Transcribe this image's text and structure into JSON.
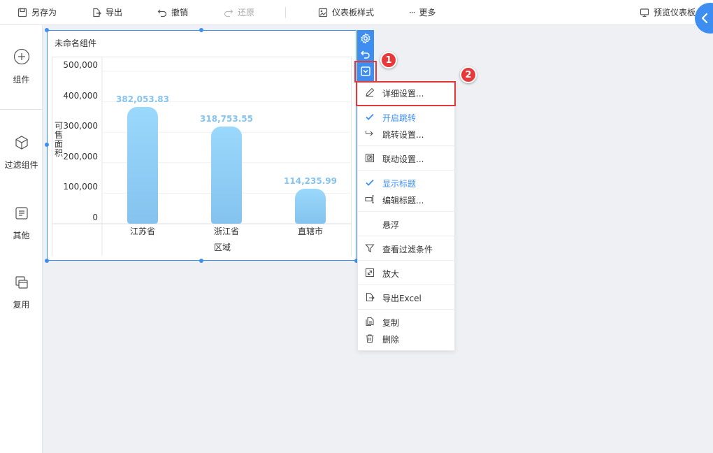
{
  "toolbar": {
    "save_as": "另存为",
    "export": "导出",
    "undo": "撤销",
    "redo": "还原",
    "style": "仪表板样式",
    "more": "更多",
    "preview": "预览仪表板"
  },
  "sidebar": {
    "items": [
      {
        "label": "组件",
        "icon": "add-circle-icon"
      },
      {
        "label": "过滤组件",
        "icon": "cube-icon"
      },
      {
        "label": "其他",
        "icon": "document-icon"
      },
      {
        "label": "复用",
        "icon": "reuse-icon"
      }
    ]
  },
  "widget": {
    "title": "未命名组件"
  },
  "chart_data": {
    "type": "bar",
    "categories": [
      "江苏省",
      "浙江省",
      "直辖市"
    ],
    "values": [
      382053.83,
      318753.55,
      114235.99
    ],
    "value_labels": [
      "382,053.83",
      "318,753.55",
      "114,235.99"
    ],
    "xlabel": "区域",
    "ylabel": "可售面积",
    "ylim": [
      0,
      500000
    ],
    "yticks": [
      0,
      100000,
      200000,
      300000,
      400000,
      500000
    ],
    "ytick_labels": [
      "0",
      "100,000",
      "200,000",
      "300,000",
      "400,000",
      "500,000"
    ],
    "bar_color": "#8fcdf6",
    "grid": true,
    "legend": "none"
  },
  "widget_tools": [
    "settings-gear-icon",
    "undo-icon",
    "dropdown-menu-icon"
  ],
  "menu": {
    "items": [
      {
        "label": "详细设置...",
        "icon": "edit-pencil-icon",
        "checked": false
      },
      {
        "label": "开启跳转",
        "icon": "check-icon",
        "checked": true
      },
      {
        "label": "跳转设置...",
        "icon": "jump-arrow-icon",
        "checked": false
      },
      {
        "label": "联动设置...",
        "icon": "link-icon",
        "checked": false
      },
      {
        "label": "显示标题",
        "icon": "check-icon",
        "checked": true
      },
      {
        "label": "编辑标题...",
        "icon": "edit-title-icon",
        "checked": false
      },
      {
        "label": "悬浮",
        "icon": "",
        "checked": false
      },
      {
        "label": "查看过滤条件",
        "icon": "filter-funnel-icon",
        "checked": false
      },
      {
        "label": "放大",
        "icon": "expand-icon",
        "checked": false
      },
      {
        "label": "导出Excel",
        "icon": "export-file-icon",
        "checked": false
      },
      {
        "label": "复制",
        "icon": "copy-icon",
        "checked": false
      },
      {
        "label": "删除",
        "icon": "trash-icon",
        "checked": false
      }
    ]
  },
  "callouts": [
    "1",
    "2"
  ],
  "colors": {
    "accent": "#3d8ef0",
    "highlight": "#e23a3a",
    "canvas": "#eff0f4"
  }
}
